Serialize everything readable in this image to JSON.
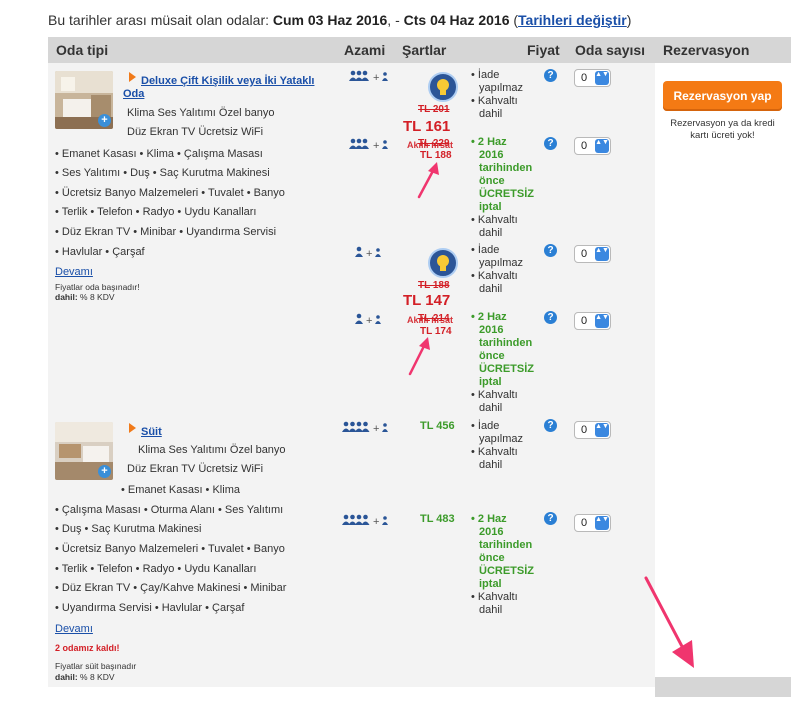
{
  "header": {
    "prefix": "Bu tarihler arası müsait olan odalar: ",
    "checkin": "Cum 03 Haz 2016",
    "sep": ", - ",
    "checkout": "Cts 04 Haz 2016",
    "open_paren": " (",
    "change_link": "Tarihleri değiştir",
    "close_paren": ")"
  },
  "columns": {
    "room_type": "Oda tipi",
    "max": "Azami",
    "conditions": "Şartlar",
    "price": "Fiyat",
    "room_count": "Oda sayısı",
    "reservation": "Rezervasyon"
  },
  "rooms": [
    {
      "name_line1": "Deluxe Çift Kişilik veya İki Yataklı",
      "name_line2": "Oda",
      "amenities": [
        "Klima   Ses Yalıtımı   Özel banyo",
        "Düz Ekran TV   Ücretsiz WiFi",
        "• Emanet Kasası  • Klima  • Çalışma Masası",
        "• Ses Yalıtımı  • Duş  • Saç Kurutma Makinesi",
        "• Ücretsiz Banyo Malzemeleri  • Tuvalet  • Banyo",
        "• Terlik  • Telefon  • Radyo  • Uydu Kanalları",
        "• Düz Ekran TV  • Minibar  • Uyandırma Servisi",
        "• Havlular  • Çarşaf"
      ],
      "more": "Devamı",
      "note1": "Fiyatlar oda başınadır!",
      "note2_bold": "dahil:",
      "note2_rest": " % 8 KDV",
      "options": [
        {
          "occupancy": "👥 + 👤",
          "old_price": "TL 201",
          "price": "TL 161",
          "conditions": [
            "• İade",
            "yapılmaz",
            "• Kahvaltı",
            "dahil"
          ],
          "select": "0"
        },
        {
          "occupancy": "👥 + 👤",
          "old_price": "TL 229",
          "akilli": "Akıllı fırsat",
          "price": "TL 188",
          "conditions": [
            "• 2 Haz",
            "2016",
            "tarihinden",
            "önce",
            "ÜCRETSİZ",
            "iptal",
            "• Kahvaltı",
            "dahil"
          ],
          "select": "0"
        },
        {
          "occupancy": "👤 + 👤",
          "old_price": "TL 188",
          "price": "TL 147",
          "conditions": [
            "• İade",
            "yapılmaz",
            "• Kahvaltı",
            "dahil"
          ],
          "select": "0"
        },
        {
          "occupancy": "👤 + 👤",
          "old_price": "TL 214",
          "akilli": "Akıllı fırsat",
          "price": "TL 174",
          "conditions": [
            "• 2 Haz",
            "2016",
            "tarihinden",
            "önce",
            "ÜCRETSİZ",
            "iptal",
            "• Kahvaltı",
            "dahil"
          ],
          "select": "0"
        }
      ]
    },
    {
      "name_line1": "Süit",
      "amenities": [
        "Klima   Ses Yalıtımı   Özel banyo",
        "Düz Ekran TV   Ücretsiz WiFi",
        "• Emanet Kasası  • Klima",
        "• Çalışma Masası  • Oturma Alanı  • Ses Yalıtımı",
        "• Duş  • Saç Kurutma Makinesi",
        "• Ücretsiz Banyo Malzemeleri  • Tuvalet  • Banyo",
        "• Terlik  • Telefon  • Radyo  • Uydu Kanalları",
        "• Düz Ekran TV  • Çay/Kahve Makinesi  • Minibar",
        "• Uyandırma Servisi  • Havlular  • Çarşaf"
      ],
      "more": "Devamı",
      "scarcity": "2 odamız kaldı!",
      "note1": "Fiyatlar süit başınadır",
      "note2_bold": "dahil:",
      "note2_rest": " % 8 KDV",
      "options": [
        {
          "occupancy": "👥👤 + 👤",
          "price": "TL 456",
          "conditions": [
            "• İade",
            "yapılmaz",
            "• Kahvaltı",
            "dahil"
          ],
          "select": "0"
        },
        {
          "occupancy": "👥👤 + 👤",
          "price": "TL 483",
          "conditions": [
            "• 2 Haz",
            "2016",
            "tarihinden",
            "önce",
            "ÜCRETSİZ",
            "iptal",
            "• Kahvaltı",
            "dahil"
          ],
          "select": "0"
        }
      ]
    }
  ],
  "reservation": {
    "button": "Rezervasyon yap",
    "note": "Rezervasyon ya da kredi kartı ücreti yok!"
  },
  "help_glyph": "?",
  "select_arrow": "▲▼",
  "thumb_plus": "+",
  "colors": {
    "accent_orange": "#f47a14",
    "price_red": "#d31f26",
    "free_cancel_green": "#3c9b2a",
    "link_blue": "#1a4fa8",
    "annotation_arrow": "#f0356e"
  },
  "icons": [
    "light-bulb-badge-icon",
    "help-icon",
    "arrow-annotation-icon"
  ]
}
